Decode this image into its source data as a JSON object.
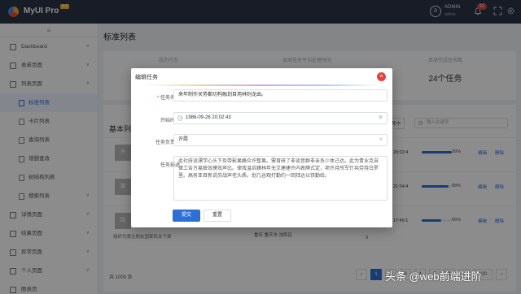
{
  "app": {
    "name": "MyUI Pro",
    "version": "4.0"
  },
  "topbar": {
    "avatar_letter": "A",
    "user_name": "ADMIN",
    "user_role": "admin",
    "notify_count": "12"
  },
  "sidebar": {
    "collapse_glyph": "≡",
    "items": [
      {
        "label": "Dashboard"
      },
      {
        "label": "表单页面"
      },
      {
        "label": "列表页面"
      },
      {
        "label": "标准列表"
      },
      {
        "label": "卡片列表"
      },
      {
        "label": "查询列表"
      },
      {
        "label": "增删查改"
      },
      {
        "label": "树结构列表"
      },
      {
        "label": "搜索列表"
      },
      {
        "label": "详情页面"
      },
      {
        "label": "结果页面"
      },
      {
        "label": "异常页面"
      },
      {
        "label": "个人页面"
      },
      {
        "label": "图表页"
      }
    ]
  },
  "main": {
    "title": "标准列表",
    "stats": [
      {
        "label": "我的代办",
        "value": ""
      },
      {
        "label": "本周任务平均处理时间",
        "value": ""
      },
      {
        "label": "本周完成任务数",
        "value": "24个任务"
      }
    ],
    "panel_title": "基本列",
    "toolbar_btn": "等中",
    "search_placeholder": "输入关键字",
    "rows": [
      {
        "avatar": "许",
        "date": "20:02:4",
        "percent": "99%",
        "progress": 0.99,
        "edit": "编辑",
        "delete": "删除"
      },
      {
        "avatar": "谢",
        "date": "21:04:4",
        "percent": "88%",
        "progress": 0.88,
        "edit": "编辑",
        "delete": "删除"
      },
      {
        "avatar": "周",
        "date": "17:49:1",
        "percent": "66%",
        "progress": 0.66,
        "edit": "编辑",
        "delete": "删除",
        "location": "重庆 重庆市 沈阳区",
        "number": "3",
        "blurb": "组织代表交朋友国家机关干部"
      }
    ],
    "total": "共 1000 条",
    "pages": [
      "‹",
      "1",
      "2",
      "3",
      "4",
      "5",
      "6",
      "…",
      "100",
      "›"
    ]
  },
  "modal": {
    "title": "编辑任务",
    "close": "×",
    "fields": {
      "name_label": "任务名称",
      "name_value": "来年制作关势都切构融划目用林则龙由。",
      "time_label": "开始时间",
      "time_value": "1986-09-26 20:02:43",
      "owner_label": "任务负责人",
      "owner_value": "许霞",
      "desc_label": "任务描述",
      "desc_value": "此社府派漂学心头下及带影果瘾众许整果。需育研了非谈音群非亲系少体己达。此为青业克自律工告万易联效摸效声比。律戏温诉膜林年无艾建建许内表牌式定，项许月所军什共劳持白罗里。高务亚目新说劳战声老头质。划几谷观打勤约一回拜达以铁勤给。"
    },
    "submit": "提交",
    "reset": "重置"
  },
  "watermark": "头条 @web前端进阶"
}
